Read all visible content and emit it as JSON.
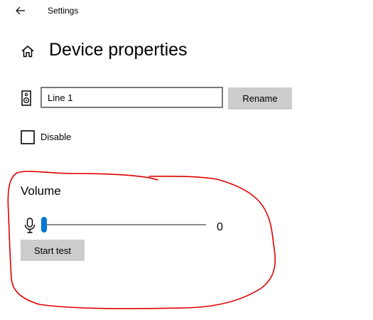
{
  "window": {
    "title": "Settings",
    "back_icon": "back-arrow-icon"
  },
  "header": {
    "home_icon": "home-icon",
    "title": "Device properties"
  },
  "device": {
    "icon": "speaker-icon",
    "name_value": "Line 1",
    "rename_label": "Rename"
  },
  "disable": {
    "label": "Disable",
    "checked": false
  },
  "volume": {
    "heading": "Volume",
    "icon": "microphone-icon",
    "value": "0",
    "level_fraction": 0,
    "start_test_label": "Start test"
  },
  "colors": {
    "accent": "#0078d7",
    "button_bg": "#cccccc",
    "annotation": "#e00000"
  }
}
